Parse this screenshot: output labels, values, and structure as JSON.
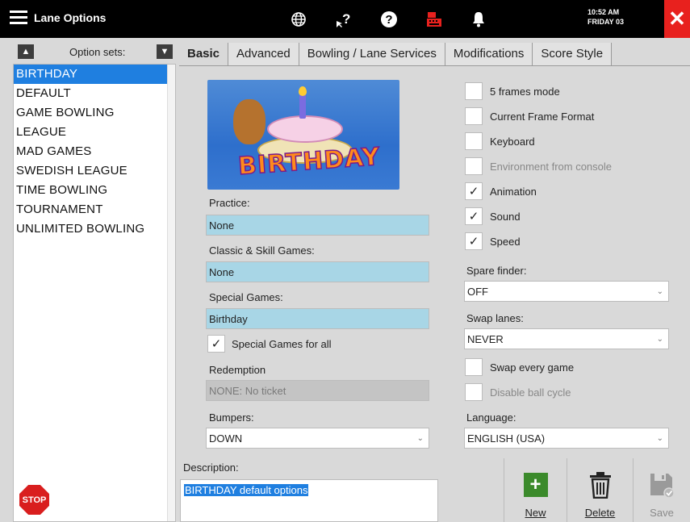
{
  "header": {
    "title": "Lane Options",
    "time": "10:52 AM",
    "date": "FRIDAY 03",
    "icons": [
      "menu-icon",
      "globe-icon",
      "help-arrow-icon",
      "question-icon",
      "cash-register-icon",
      "bell-icon",
      "close-icon"
    ],
    "close_color": "#e8211e"
  },
  "sidebar": {
    "label": "Option sets:",
    "items": [
      {
        "label": "BIRTHDAY",
        "selected": true
      },
      {
        "label": "DEFAULT"
      },
      {
        "label": "GAME BOWLING"
      },
      {
        "label": "LEAGUE"
      },
      {
        "label": "MAD GAMES"
      },
      {
        "label": "SWEDISH LEAGUE"
      },
      {
        "label": "TIME BOWLING"
      },
      {
        "label": "TOURNAMENT"
      },
      {
        "label": "UNLIMITED BOWLING"
      }
    ],
    "stop_label": "STOP",
    "selected_color": "#1f7fe0"
  },
  "tabs": [
    {
      "label": "Basic",
      "active": true
    },
    {
      "label": "Advanced"
    },
    {
      "label": "Bowling / Lane Services"
    },
    {
      "label": "Modifications"
    },
    {
      "label": "Score Style"
    }
  ],
  "basic": {
    "image_text": "BIRTHDAY",
    "practice": {
      "label": "Practice:",
      "value": "None"
    },
    "classic": {
      "label": "Classic & Skill Games:",
      "value": "None"
    },
    "special": {
      "label": "Special Games:",
      "value": "Birthday"
    },
    "special_all": {
      "label": "Special Games for all",
      "checked": true
    },
    "redemption": {
      "label": "Redemption",
      "value": "NONE: No ticket"
    },
    "bumpers": {
      "label": "Bumpers:",
      "value": "DOWN"
    },
    "checks": [
      {
        "label": "5 frames mode",
        "checked": false,
        "enabled": true
      },
      {
        "label": "Current Frame Format",
        "checked": false,
        "enabled": true
      },
      {
        "label": "Keyboard",
        "checked": false,
        "enabled": true
      },
      {
        "label": "Environment from console",
        "checked": false,
        "enabled": false
      },
      {
        "label": "Animation",
        "checked": true,
        "enabled": true
      },
      {
        "label": "Sound",
        "checked": true,
        "enabled": true
      },
      {
        "label": "Speed",
        "checked": true,
        "enabled": true
      }
    ],
    "spare_finder": {
      "label": "Spare finder:",
      "value": "OFF"
    },
    "swap_lanes": {
      "label": "Swap lanes:",
      "value": "NEVER"
    },
    "swap_every": {
      "label": "Swap every game",
      "checked": false,
      "enabled": true
    },
    "disable_ball": {
      "label": "Disable ball cycle",
      "checked": false,
      "enabled": false
    },
    "language": {
      "label": "Language:",
      "value": "ENGLISH (USA)"
    },
    "field_blue": "#a8d6e6"
  },
  "description": {
    "label": "Description:",
    "value": "BIRTHDAY default options"
  },
  "actions": {
    "new": "New",
    "delete": "Delete",
    "save": "Save"
  }
}
